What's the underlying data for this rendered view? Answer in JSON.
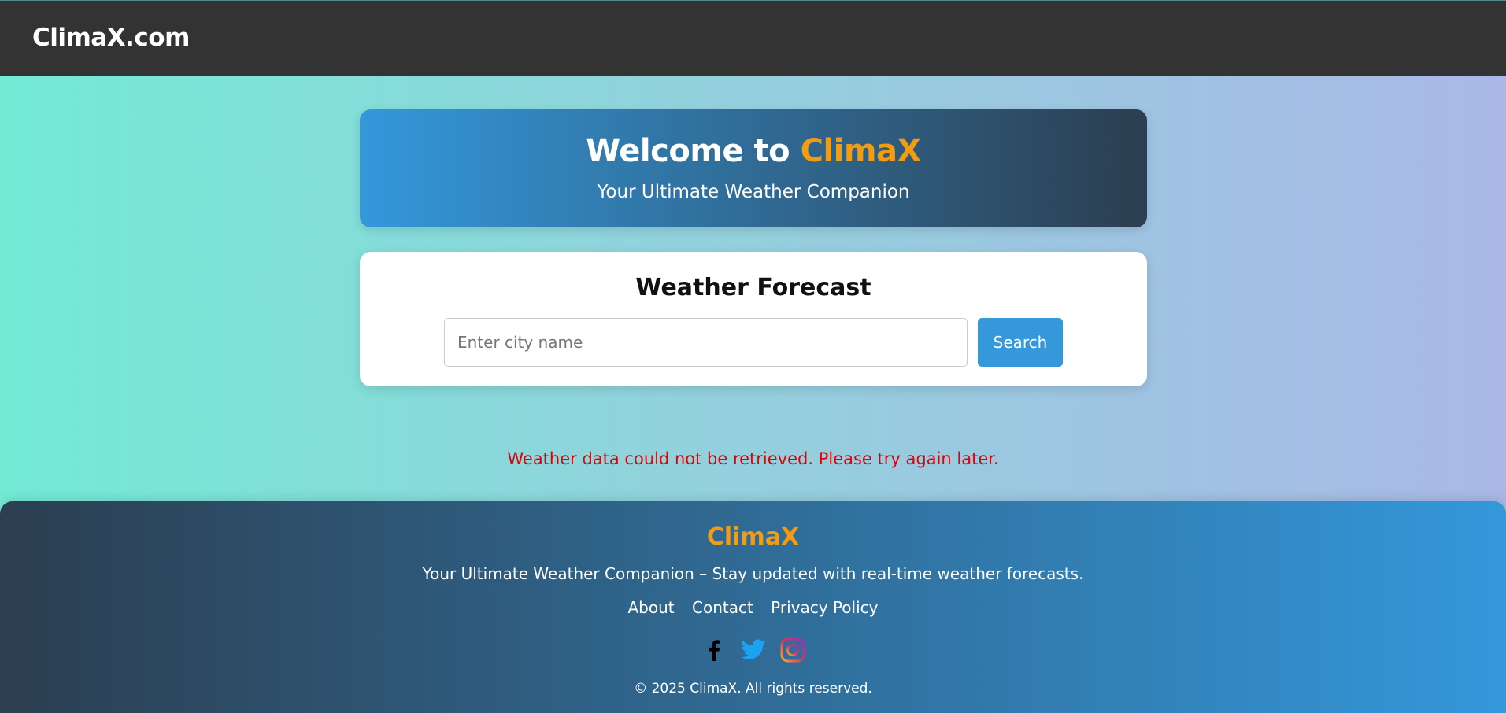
{
  "header": {
    "brand": "ClimaX.com"
  },
  "hero": {
    "title_prefix": "Welcome to",
    "title_accent": "ClimaX",
    "subtitle": "Your Ultimate Weather Companion"
  },
  "forecast": {
    "title": "Weather Forecast",
    "search_placeholder": "Enter city name",
    "search_value": "",
    "search_button": "Search"
  },
  "error": {
    "message": "Weather data could not be retrieved. Please try again later."
  },
  "footer": {
    "brand": "ClimaX",
    "tagline": "Your Ultimate Weather Companion – Stay updated with real-time weather forecasts.",
    "links": [
      "About",
      "Contact",
      "Privacy Policy"
    ],
    "social_icons": [
      "facebook-icon",
      "twitter-icon",
      "instagram-icon"
    ],
    "copyright": "© 2025 ClimaX. All rights reserved."
  },
  "colors": {
    "accent": "#f39c12",
    "primary": "#3498db",
    "dark": "#2c3e50",
    "error": "#e30000",
    "topbar": "#333333"
  }
}
